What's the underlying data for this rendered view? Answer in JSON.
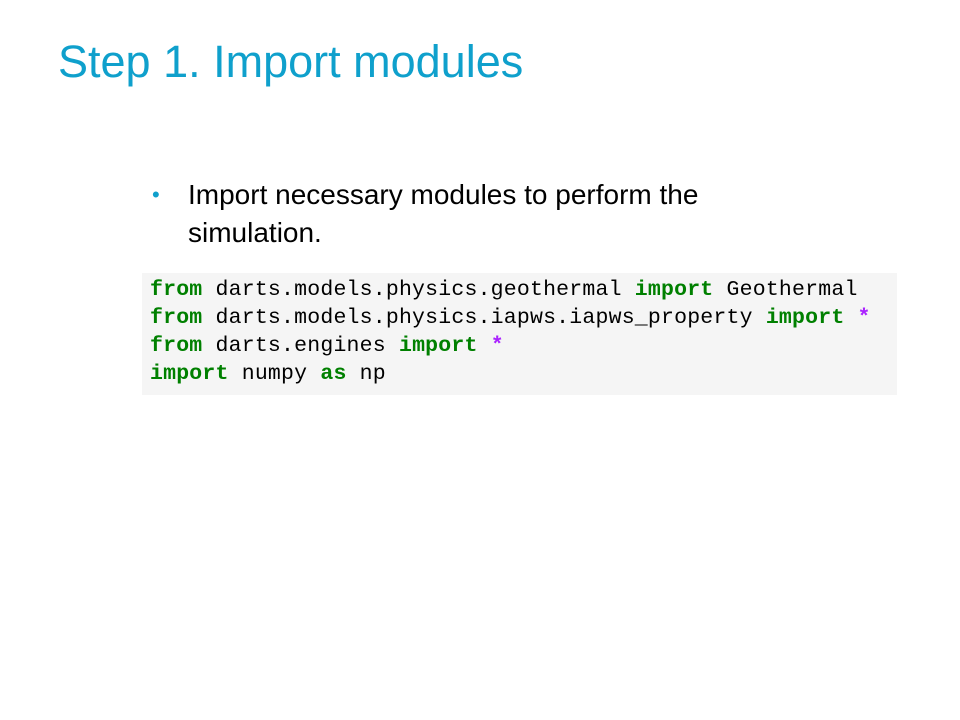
{
  "title": "Step 1. Import modules",
  "bullet": {
    "marker": "•",
    "text": "Import necessary modules to perform the simulation."
  },
  "colors": {
    "accent": "#0FA0CC",
    "keyword": "#008000",
    "operator": "#AA22FF",
    "code_bg": "#F5F5F5"
  },
  "code": {
    "lines": [
      [
        {
          "t": "kw",
          "v": "from"
        },
        {
          "t": "n",
          "v": " darts.models.physics.geothermal "
        },
        {
          "t": "kw",
          "v": "import"
        },
        {
          "t": "n",
          "v": " Geothermal"
        }
      ],
      [
        {
          "t": "kw",
          "v": "from"
        },
        {
          "t": "n",
          "v": " darts.models.physics.iapws.iapws_property "
        },
        {
          "t": "kw",
          "v": "import"
        },
        {
          "t": "n",
          "v": " "
        },
        {
          "t": "op",
          "v": "*"
        }
      ],
      [
        {
          "t": "kw",
          "v": "from"
        },
        {
          "t": "n",
          "v": " darts.engines "
        },
        {
          "t": "kw",
          "v": "import"
        },
        {
          "t": "n",
          "v": " "
        },
        {
          "t": "op",
          "v": "*"
        }
      ],
      [
        {
          "t": "kw",
          "v": "import"
        },
        {
          "t": "n",
          "v": " numpy "
        },
        {
          "t": "kw",
          "v": "as"
        },
        {
          "t": "n",
          "v": " np"
        }
      ]
    ]
  }
}
